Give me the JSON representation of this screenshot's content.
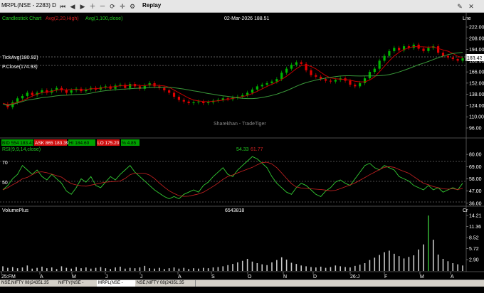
{
  "toolbar": {
    "title": "MRPL(NSE - 2283) D",
    "replay_label": "Replay",
    "right_label": "Lne"
  },
  "price_panel": {
    "header_left": "Candlestick Chart",
    "avg1": "Avg(2,20,High)",
    "avg2": "Avg(1,100,close)",
    "header_center": "02-Mar-2026 188.51",
    "tickavg": "TickAvg(180.92)",
    "pclose": "P.Close(174.93)",
    "watermark": "Sharekhan - TradeTiger",
    "last_price": "183.42",
    "y_ticks": [
      "222.00",
      "208.00",
      "194.00",
      "180.00",
      "166.00",
      "152.00",
      "138.00",
      "124.00",
      "110.00",
      "96.00"
    ]
  },
  "ohlc": {
    "bid": "BID 554 183.43",
    "ask": "ASK 865 183.39",
    "hi": "HI 184.60",
    "lo": "LO 175.20",
    "chg": "% 4.85"
  },
  "rsi_panel": {
    "label": "RSI(9,9,14,close)",
    "val1": "54.33",
    "val2": "61.77",
    "y_ticks": [
      "80.00",
      "69.00",
      "58.00",
      "47.00",
      "36.00"
    ],
    "left_levels": [
      "70",
      "50"
    ]
  },
  "vol_panel": {
    "label": "VolumePlus",
    "center_value": "6543818",
    "right_label": "Cr",
    "y_ticks": [
      "14.21",
      "11.36",
      "8.52",
      "5.72",
      "2.90"
    ]
  },
  "x_axis": {
    "labels": [
      "25:FM",
      "A",
      "M",
      "J",
      "J",
      "A",
      "S",
      "O",
      "N",
      "D",
      "26:J",
      "F",
      "M",
      "A"
    ]
  },
  "price_series": [
    126,
    122,
    128,
    133,
    136,
    140,
    137,
    140,
    143,
    140,
    143,
    146,
    143,
    140,
    143,
    145,
    142,
    144,
    146,
    144,
    147,
    148,
    145,
    149,
    150,
    146,
    151,
    148,
    145,
    149,
    152,
    148,
    146,
    143,
    140,
    135,
    131,
    129,
    127,
    128,
    129,
    127,
    128,
    130,
    131,
    133,
    132,
    134,
    135,
    137,
    140,
    144,
    148,
    150,
    152,
    154,
    157,
    165,
    170,
    175,
    178,
    176,
    168,
    162,
    160,
    157,
    155,
    154,
    156,
    158,
    155,
    150,
    148,
    152,
    158,
    166,
    170,
    180,
    186,
    192,
    196,
    193,
    198,
    196,
    200,
    195,
    192,
    196,
    198,
    190,
    186,
    184,
    182,
    180,
    183
  ],
  "rsi_series": [
    48,
    52,
    58,
    62,
    70,
    66,
    62,
    66,
    60,
    57,
    62,
    58,
    54,
    47,
    44,
    50,
    58,
    55,
    60,
    52,
    50,
    55,
    60,
    57,
    62,
    66,
    70,
    64,
    60,
    56,
    52,
    48,
    45,
    42,
    40,
    42,
    40,
    44,
    46,
    48,
    46,
    52,
    55,
    60,
    64,
    68,
    62,
    60,
    66,
    70,
    74,
    78,
    76,
    72,
    68,
    60,
    54,
    50,
    46,
    44,
    50,
    54,
    52,
    48,
    44,
    42,
    47,
    50,
    55,
    57,
    54,
    52,
    58,
    64,
    70,
    72,
    68,
    66,
    70,
    68,
    66,
    60,
    58,
    56,
    52,
    50,
    48,
    52,
    48,
    50,
    46,
    48,
    50,
    48,
    54
  ],
  "volume_series": [
    1.2,
    0.8,
    1.0,
    0.7,
    0.9,
    1.4,
    0.6,
    0.8,
    1.1,
    0.7,
    0.9,
    0.5,
    1.2,
    0.8,
    0.6,
    1.0,
    0.7,
    0.9,
    0.6,
    0.8,
    1.0,
    0.7,
    0.5,
    0.9,
    1.1,
    0.6,
    0.8,
    0.7,
    0.9,
    1.3,
    0.7,
    0.6,
    0.8,
    0.5,
    0.7,
    0.9,
    0.6,
    0.8,
    0.5,
    0.7,
    0.6,
    0.8,
    0.7,
    0.9,
    1.0,
    1.2,
    1.5,
    1.8,
    2.2,
    2.6,
    3.1,
    2.4,
    2.0,
    1.7,
    1.5,
    2.2,
    2.8,
    3.5,
    2.9,
    2.1,
    1.8,
    1.4,
    1.2,
    1.0,
    0.9,
    1.1,
    0.8,
    1.0,
    1.4,
    1.2,
    1.0,
    0.9,
    1.3,
    1.6,
    2.0,
    2.8,
    3.4,
    4.1,
    4.8,
    5.2,
    4.4,
    3.8,
    3.2,
    3.6,
    4.0,
    5.5,
    6.8,
    14.2,
    8.0,
    4.2,
    3.1,
    2.5,
    2.0,
    1.7,
    1.4
  ],
  "statusbar": {
    "tabs": [
      "NSE,NIFTY 08(24351.35 TS:08:40:4",
      "NIFTY(NSE - 20000) D",
      "MRPL(NSE - 2283) D",
      "NSE,NIFTY 08(24351.35 TS:08:40:3"
    ],
    "active_index": 2
  },
  "colors": {
    "up": "#00b400",
    "down": "#e00000",
    "avg_red": "#c00000",
    "avg_green": "#3a9a3a",
    "rsi_green": "#33cc33",
    "rsi_red": "#cc2222",
    "volume": "#c8c8c8",
    "volume_peak": "#33aa33",
    "panel_label_green": "#22cc22"
  }
}
